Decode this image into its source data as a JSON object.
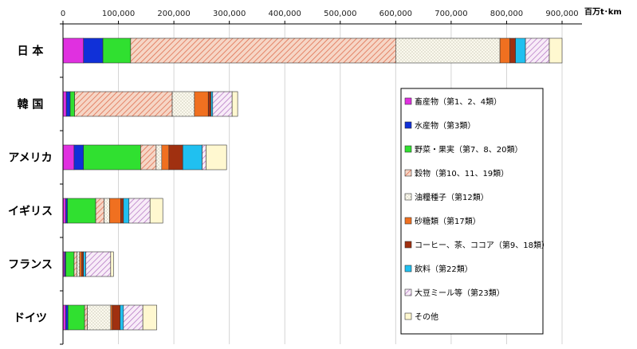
{
  "chart_data": {
    "type": "bar",
    "orientation": "horizontal",
    "stacked": true,
    "unit": "百万t･km",
    "xlim": [
      0,
      900000
    ],
    "x_ticks": [
      "0",
      "100,000",
      "200,000",
      "300,000",
      "400,000",
      "500,000",
      "600,000",
      "700,000",
      "800,000",
      "900,000"
    ],
    "categories": [
      "日 本",
      "韓 国",
      "アメリカ",
      "イギリス",
      "フランス",
      "ドイツ"
    ],
    "series": [
      {
        "name": "畜産物（第1、2、4類）",
        "color": "#e030e0",
        "pattern": "solid",
        "values": [
          37000,
          6000,
          20000,
          5000,
          3000,
          5000
        ]
      },
      {
        "name": "水産物（第3類）",
        "color": "#1030d8",
        "pattern": "solid",
        "values": [
          35000,
          7000,
          17000,
          3000,
          2000,
          4000
        ]
      },
      {
        "name": "野菜・果実（第7、8、20類）",
        "color": "#30e030",
        "pattern": "solid",
        "values": [
          50000,
          8000,
          103000,
          51000,
          15000,
          30000
        ]
      },
      {
        "name": "穀物（第10、11、19類）",
        "color": "#f0a080",
        "pattern": "hatch",
        "values": [
          478000,
          176000,
          28000,
          15000,
          5000,
          5000
        ]
      },
      {
        "name": "油糧種子（第12類）",
        "color": "#f0ecd8",
        "pattern": "dots",
        "values": [
          188000,
          40000,
          10000,
          10000,
          5000,
          42000
        ]
      },
      {
        "name": "砂糖類（第17類）",
        "color": "#f07020",
        "pattern": "solid",
        "values": [
          18000,
          25000,
          13000,
          20000,
          4000,
          3000
        ]
      },
      {
        "name": "コーヒー、茶、ココア（第9、18類）",
        "color": "#a03010",
        "pattern": "solid",
        "values": [
          10000,
          5000,
          25000,
          5000,
          3000,
          14000
        ]
      },
      {
        "name": "飲料（第22類）",
        "color": "#20c0f0",
        "pattern": "solid",
        "values": [
          18000,
          3000,
          35000,
          10000,
          4000,
          6000
        ]
      },
      {
        "name": "大豆ミール等（第23類）",
        "color": "#e8c8ec",
        "pattern": "hatch",
        "values": [
          43000,
          35000,
          7000,
          38000,
          45000,
          35000
        ]
      },
      {
        "name": "その他",
        "color": "#fff8d0",
        "pattern": "solid",
        "values": [
          23000,
          10000,
          37000,
          23000,
          5000,
          25000
        ]
      }
    ],
    "legend_position": "right",
    "grid": true
  }
}
